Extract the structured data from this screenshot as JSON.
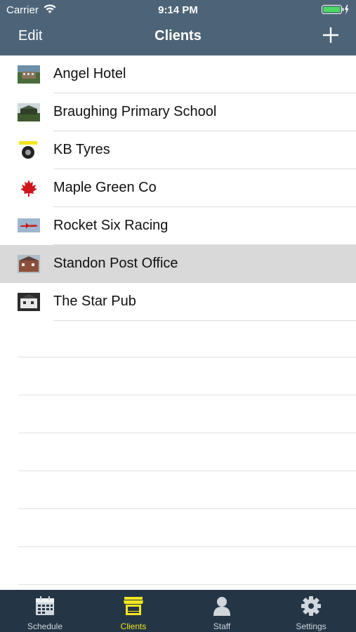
{
  "status_bar": {
    "carrier": "Carrier",
    "time": "9:14 PM"
  },
  "nav": {
    "edit_label": "Edit",
    "title": "Clients",
    "add_icon": "plus-icon"
  },
  "clients": [
    {
      "name": "Angel Hotel",
      "thumb": "hotel-photo"
    },
    {
      "name": "Braughing Primary School",
      "thumb": "school-photo"
    },
    {
      "name": "KB Tyres",
      "thumb": "tyre-photo"
    },
    {
      "name": "Maple Green Co",
      "thumb": "maple-leaf"
    },
    {
      "name": "Rocket Six Racing",
      "thumb": "plane-photo"
    },
    {
      "name": "Standon Post Office",
      "thumb": "post-office-photo",
      "selected": true
    },
    {
      "name": "The Star Pub",
      "thumb": "pub-photo"
    }
  ],
  "tabs": [
    {
      "label": "Schedule",
      "icon": "calendar-icon"
    },
    {
      "label": "Clients",
      "icon": "store-icon",
      "active": true
    },
    {
      "label": "Staff",
      "icon": "person-icon"
    },
    {
      "label": "Settings",
      "icon": "gear-icon"
    }
  ],
  "colors": {
    "nav_bg": "#4d6478",
    "tabbar_bg": "#243646",
    "active_tab": "#f3e51e",
    "selected_row": "#d9d9d9"
  }
}
